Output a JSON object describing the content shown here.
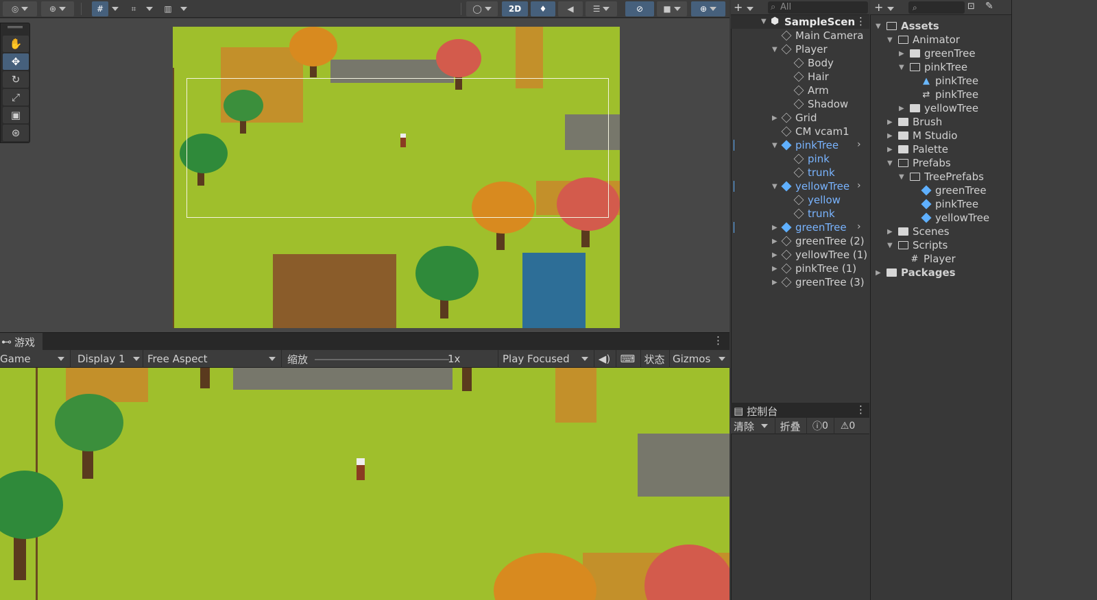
{
  "toolbar": {
    "btn_2d": "2D"
  },
  "scene_tools": [
    "hand-tool",
    "move-tool",
    "rotate-tool",
    "scale-tool",
    "rect-tool",
    "transform-tool"
  ],
  "hierarchy": {
    "search_placeholder": "All",
    "scene_name": "SampleScen",
    "items": [
      {
        "label": "Main Camera",
        "depth": 1,
        "blue": false
      },
      {
        "label": "Player",
        "depth": 1,
        "blue": false,
        "expanded": true
      },
      {
        "label": "Body",
        "depth": 2,
        "blue": false
      },
      {
        "label": "Hair",
        "depth": 2,
        "blue": false
      },
      {
        "label": "Arm",
        "depth": 2,
        "blue": false
      },
      {
        "label": "Shadow",
        "depth": 2,
        "blue": false
      },
      {
        "label": "Grid",
        "depth": 1,
        "blue": false,
        "collapsed": true
      },
      {
        "label": "CM vcam1",
        "depth": 1,
        "blue": false
      },
      {
        "label": "pinkTree",
        "depth": 1,
        "blue": true,
        "expanded": true
      },
      {
        "label": "pink",
        "depth": 2,
        "blue": true
      },
      {
        "label": "trunk",
        "depth": 2,
        "blue": true
      },
      {
        "label": "yellowTree",
        "depth": 1,
        "blue": true,
        "expanded": true
      },
      {
        "label": "yellow",
        "depth": 2,
        "blue": true
      },
      {
        "label": "trunk",
        "depth": 2,
        "blue": true
      },
      {
        "label": "greenTree",
        "depth": 1,
        "blue": true,
        "collapsed": true
      },
      {
        "label": "greenTree (2)",
        "depth": 1,
        "blue": false,
        "collapsed": true
      },
      {
        "label": "yellowTree (1)",
        "depth": 1,
        "blue": false,
        "collapsed": true
      },
      {
        "label": "pinkTree (1)",
        "depth": 1,
        "blue": false,
        "collapsed": true
      },
      {
        "label": "greenTree (3)",
        "depth": 1,
        "blue": false,
        "collapsed": true
      }
    ]
  },
  "game": {
    "tab_label": "游戏",
    "mode": "Game",
    "display": "Display 1",
    "aspect": "Free Aspect",
    "scale_label": "缩放",
    "scale_value": "1x",
    "play_mode": "Play Focused",
    "stats": "状态",
    "gizmos": "Gizmos"
  },
  "console": {
    "tab_label": "控制台",
    "clear": "清除",
    "collapse": "折叠",
    "error_count": "0",
    "warn_count": "0"
  },
  "project": {
    "items": [
      {
        "label": "Assets",
        "depth": 0,
        "bold": true,
        "type": "folder-open"
      },
      {
        "label": "Animator",
        "depth": 1,
        "type": "folder-open"
      },
      {
        "label": "greenTree",
        "depth": 2,
        "type": "folder"
      },
      {
        "label": "pinkTree",
        "depth": 2,
        "type": "folder-open"
      },
      {
        "label": "pinkTree",
        "depth": 3,
        "type": "anim"
      },
      {
        "label": "pinkTree",
        "depth": 3,
        "type": "controller"
      },
      {
        "label": "yellowTree",
        "depth": 2,
        "type": "folder"
      },
      {
        "label": "Brush",
        "depth": 1,
        "type": "folder"
      },
      {
        "label": "M Studio",
        "depth": 1,
        "type": "folder"
      },
      {
        "label": "Palette",
        "depth": 1,
        "type": "folder"
      },
      {
        "label": "Prefabs",
        "depth": 1,
        "type": "folder-open"
      },
      {
        "label": "TreePrefabs",
        "depth": 2,
        "type": "folder-open"
      },
      {
        "label": "greenTree",
        "depth": 3,
        "type": "prefab"
      },
      {
        "label": "pinkTree",
        "depth": 3,
        "type": "prefab"
      },
      {
        "label": "yellowTree",
        "depth": 3,
        "type": "prefab"
      },
      {
        "label": "Scenes",
        "depth": 1,
        "type": "folder"
      },
      {
        "label": "Scripts",
        "depth": 1,
        "type": "folder-open"
      },
      {
        "label": "Player",
        "depth": 2,
        "type": "script"
      },
      {
        "label": "Packages",
        "depth": 0,
        "bold": true,
        "type": "folder"
      }
    ]
  },
  "colors": {
    "grass": "#9fbf2c",
    "dirt": "#c9872a",
    "selection": "#46607c",
    "prefab_blue": "#79b4ff"
  }
}
